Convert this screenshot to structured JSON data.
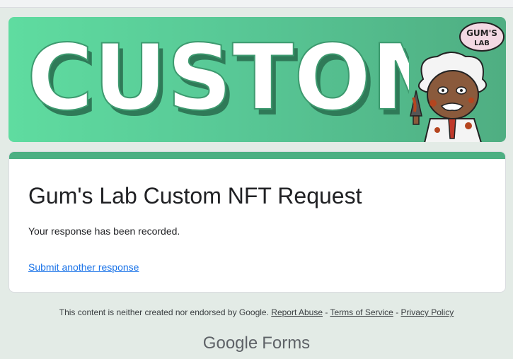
{
  "banner": {
    "word": "CUSTOM",
    "logo_text": "GUM'S LAB",
    "colors": {
      "background_start": "#5fdca0",
      "background_end": "#4fae82",
      "word_fill": "#ffffff",
      "word_shadow": "#2f7a58"
    }
  },
  "form": {
    "title": "Gum's Lab Custom NFT Request",
    "confirmation": "Your response has been recorded.",
    "submit_another": "Submit another response",
    "accent_color": "#4caf82"
  },
  "footer": {
    "disclaimer": "This content is neither created nor endorsed by Google.",
    "report_abuse": "Report Abuse",
    "terms": "Terms of Service",
    "privacy": "Privacy Policy",
    "separator": "-"
  },
  "brand": {
    "google": "Google",
    "forms": "Forms"
  },
  "icons": [
    "gums-lab-logo-icon",
    "scientist-character-icon"
  ]
}
